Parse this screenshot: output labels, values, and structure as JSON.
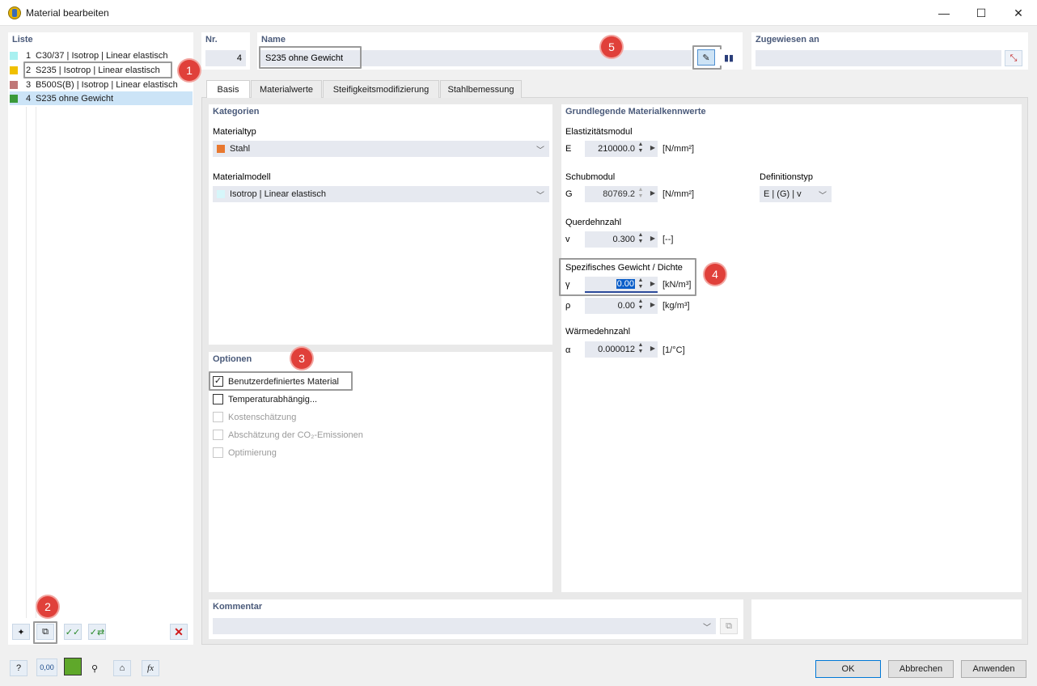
{
  "window": {
    "title": "Material bearbeiten",
    "minimize": "—",
    "maximize": "☐",
    "close": "✕"
  },
  "list": {
    "label": "Liste",
    "items": [
      {
        "num": "1",
        "text": "C30/37 | Isotrop | Linear elastisch",
        "color": "#a8f0f0"
      },
      {
        "num": "2",
        "text": "S235 | Isotrop | Linear elastisch",
        "color": "#f0c000"
      },
      {
        "num": "3",
        "text": "B500S(B) | Isotrop | Linear elastisch",
        "color": "#c07878"
      },
      {
        "num": "4",
        "text": "S235 ohne Gewicht",
        "color": "#3a9a3a"
      }
    ]
  },
  "header": {
    "nr_label": "Nr.",
    "nr_value": "4",
    "name_label": "Name",
    "name_value": "S235 ohne Gewicht",
    "assigned_label": "Zugewiesen an",
    "assigned_value": ""
  },
  "tabs": [
    "Basis",
    "Materialwerte",
    "Steifigkeitsmodifizierung",
    "Stahlbemessung"
  ],
  "kategorien": {
    "title": "Kategorien",
    "materialtyp_label": "Materialtyp",
    "materialtyp_value": "Stahl",
    "materialtyp_color": "#e87830",
    "materialmodell_label": "Materialmodell",
    "materialmodell_value": "Isotrop | Linear elastisch",
    "materialmodell_color": "#d6f6fa"
  },
  "optionen": {
    "title": "Optionen",
    "items": [
      {
        "label": "Benutzerdefiniertes Material",
        "checked": "✓",
        "enabled": true
      },
      {
        "label": "Temperaturabhängig...",
        "checked": "",
        "enabled": true
      },
      {
        "label": "Kostenschätzung",
        "checked": "",
        "enabled": false
      },
      {
        "label": "Abschätzung der CO₂-Emissionen",
        "checked": "",
        "enabled": false
      },
      {
        "label": "Optimierung",
        "checked": "",
        "enabled": false
      }
    ]
  },
  "kennwerte": {
    "title": "Grundlegende Materialkennwerte",
    "e_group": "Elastizitätsmodul",
    "e_sym": "E",
    "e_value": "210000.0",
    "e_unit": "[N/mm²]",
    "g_group": "Schubmodul",
    "g_sym": "G",
    "g_value": "80769.2",
    "g_unit": "[N/mm²]",
    "def_label": "Definitionstyp",
    "def_value": "E | (G) | v",
    "v_group": "Querdehnzahl",
    "v_sym": "v",
    "v_value": "0.300",
    "v_unit": "[--]",
    "gamma_group": "Spezifisches Gewicht / Dichte",
    "gamma_sym": "γ",
    "gamma_value": "0.00",
    "gamma_unit": "[kN/m³]",
    "rho_sym": "ρ",
    "rho_value": "0.00",
    "rho_unit": "[kg/m³]",
    "alpha_group": "Wärmedehnzahl",
    "alpha_sym": "α",
    "alpha_value": "0.000012",
    "alpha_unit": "[1/°C]"
  },
  "kommentar": {
    "label": "Kommentar",
    "value": ""
  },
  "buttons": {
    "ok": "OK",
    "cancel": "Abbrechen",
    "apply": "Anwenden"
  },
  "bottom_toolbar": {
    "units_icon_text": "0,00"
  },
  "callouts": [
    "1",
    "2",
    "3",
    "4",
    "5"
  ]
}
